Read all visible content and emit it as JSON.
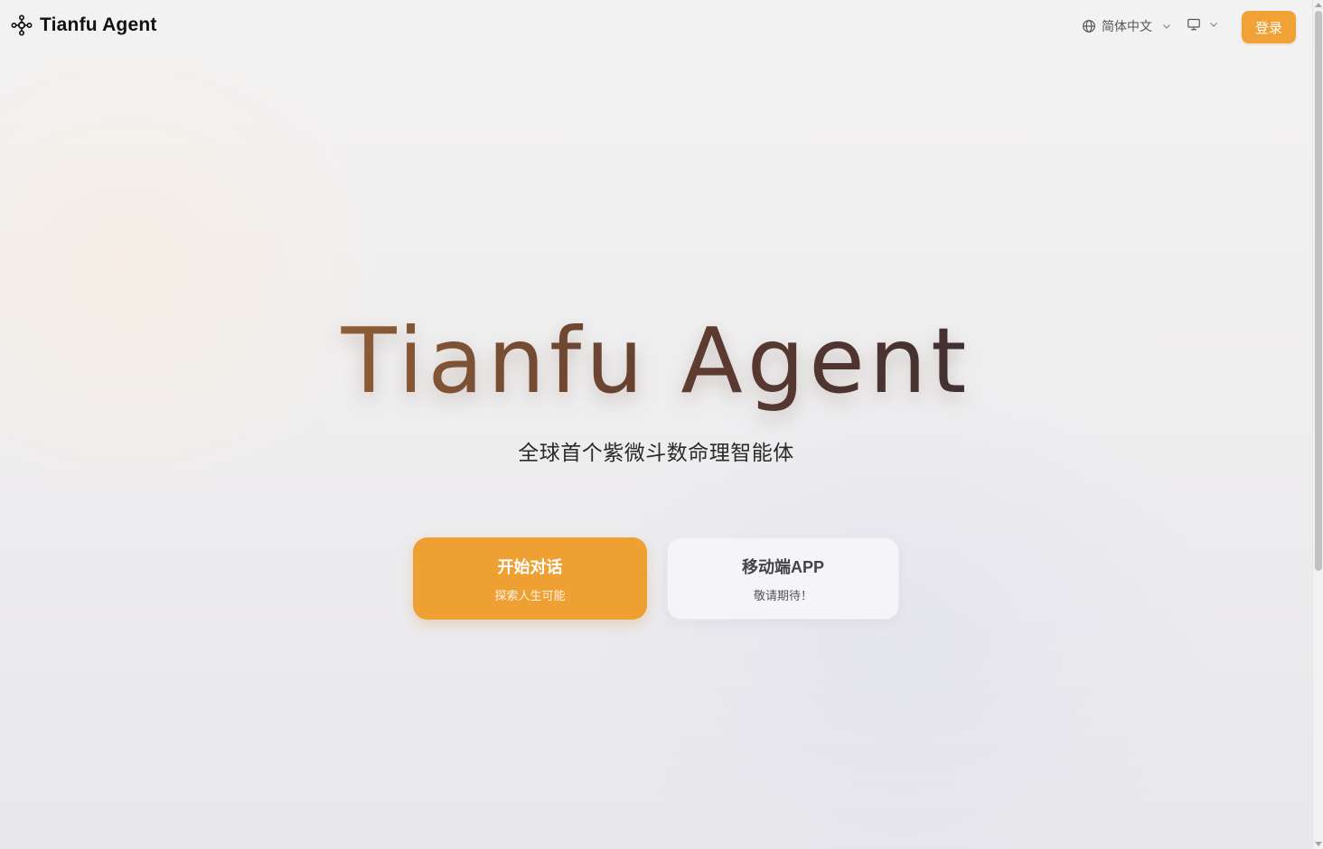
{
  "header": {
    "brand_name": "Tianfu Agent",
    "brand_icon": "network-nodes-icon",
    "language_label": "简体中文",
    "language_icon": "globe-icon",
    "display_icon": "monitor-icon",
    "login_label": "登录"
  },
  "hero": {
    "title": "Tianfu Agent",
    "subtitle": "全球首个紫微斗数命理智能体"
  },
  "actions": {
    "start_chat": {
      "title": "开始对话",
      "subtitle": "探索人生可能"
    },
    "mobile_app": {
      "title": "移动端APP",
      "subtitle": "敬请期待！"
    }
  },
  "colors": {
    "accent": "#eea033",
    "text_dark": "#111111",
    "title_gradient_start": "#c79456",
    "title_gradient_end": "#2a2630"
  }
}
